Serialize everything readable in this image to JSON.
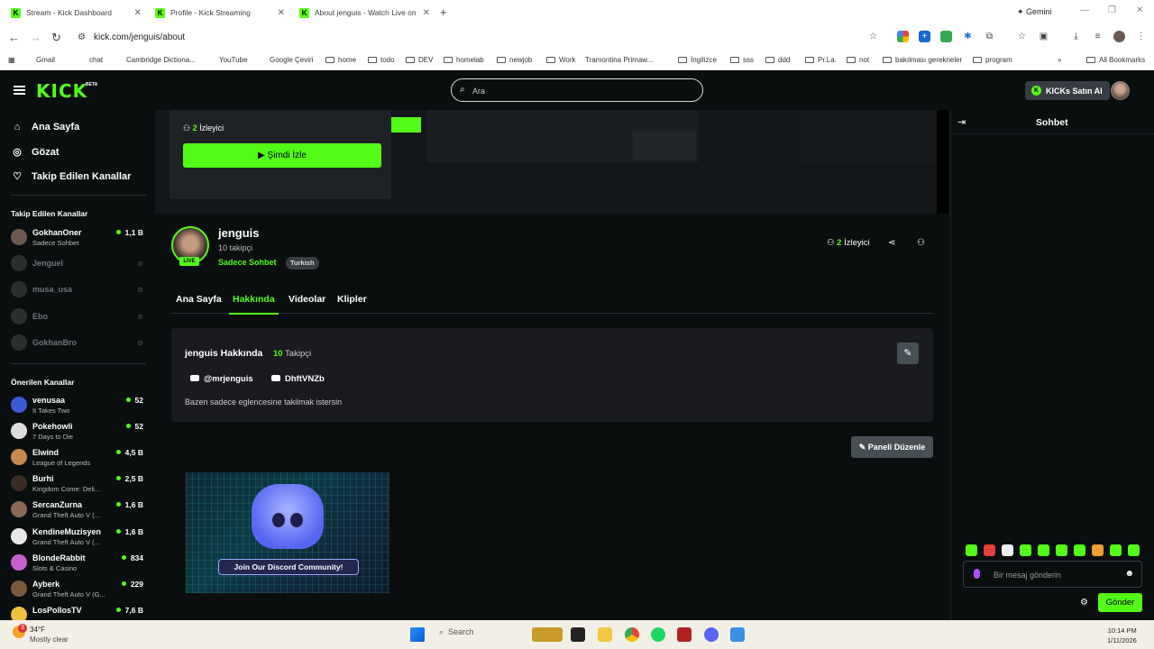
{
  "browser": {
    "tabs": [
      {
        "title": "Stream - Kick Dashboard"
      },
      {
        "title": "Profile - Kick Streaming"
      },
      {
        "title": "About jenguis - Watch Live on"
      }
    ],
    "gemini_label": "Gemini",
    "url": "kick.com/jenguis/about",
    "bookmarks": [
      "Gmail",
      "chat",
      "Cambridge Dictiona...",
      "YouTube",
      "Google Çeviri",
      "home",
      "todo",
      "DEV",
      "homelab",
      "newjob",
      "Work",
      "Tramontina Primaw...",
      "İngilizce",
      "sss",
      "ddd",
      "Pr.La.",
      "not",
      "bakılması gerekneler",
      "program"
    ],
    "all_bookmarks": "All Bookmarks"
  },
  "header": {
    "logo": "KICK",
    "beta": "BETA",
    "search_placeholder": "Ara",
    "buy_kicks": "KICKs Satın Al"
  },
  "sidebar": {
    "nav": [
      {
        "label": "Ana Sayfa",
        "icon": "home-icon"
      },
      {
        "label": "Gözat",
        "icon": "compass-icon"
      },
      {
        "label": "Takip Edilen Kanallar",
        "icon": "heart-icon"
      }
    ],
    "followed_heading": "Takip Edilen Kanallar",
    "followed": [
      {
        "name": "GokhanOner",
        "sub": "Sadece Sohbet",
        "viewers": "1,1 B",
        "live": true
      },
      {
        "name": "Jenguel",
        "live": false
      },
      {
        "name": "musa_usa",
        "live": false
      },
      {
        "name": "Ebo",
        "live": false
      },
      {
        "name": "GokhanBro",
        "live": false
      }
    ],
    "recommended_heading": "Önerilen Kanallar",
    "recommended": [
      {
        "name": "venusaa",
        "sub": "It Takes Two",
        "viewers": "52"
      },
      {
        "name": "Pokehowli",
        "sub": "7 Days to Die",
        "viewers": "52"
      },
      {
        "name": "Elwind",
        "sub": "League of Legends",
        "viewers": "4,5 B"
      },
      {
        "name": "Burhi",
        "sub": "Kingdom Come: Deli...",
        "viewers": "2,5 B"
      },
      {
        "name": "SercanZurna",
        "sub": "Grand Theft Auto V (...",
        "viewers": "1,6 B"
      },
      {
        "name": "KendineMuzisyen",
        "sub": "Grand Theft Auto V (...",
        "viewers": "1,6 B"
      },
      {
        "name": "BlondeRabbit",
        "sub": "Slots & Casino",
        "viewers": "834"
      },
      {
        "name": "Ayberk",
        "sub": "Grand Theft Auto V (G...",
        "viewers": "229"
      },
      {
        "name": "LosPollosTV",
        "sub": "",
        "viewers": "7,6 B"
      }
    ]
  },
  "player": {
    "viewers_count": "2",
    "viewers_label": "İzleyici",
    "watch_now": "▶ Şimdi İzle"
  },
  "profile": {
    "name": "jenguis",
    "followers": "10 takipçi",
    "category": "Sadece Sohbet",
    "tag": "Turkish",
    "live_badge": "LIVE",
    "viewers_count": "2",
    "viewers_label": "İzleyici"
  },
  "tabs": [
    {
      "label": "Ana Sayfa"
    },
    {
      "label": "Hakkında"
    },
    {
      "label": "Videolar"
    },
    {
      "label": "Klipler"
    }
  ],
  "about": {
    "title": "jenguis Hakkında",
    "follower_count": "10",
    "follower_label": "Takipçi",
    "youtube": "@mrjenguis",
    "discord": "DhftVNZb",
    "description": "Bazen sadece eglencesine takilmak istersin"
  },
  "panel_edit": "Paneli Düzenle",
  "discord_panel": {
    "cta": "Join Our Discord Community!"
  },
  "chat": {
    "title": "Sohbet",
    "placeholder": "Bir mesaj gönderin",
    "send": "Gönder"
  },
  "taskbar": {
    "temperature": "34°F",
    "condition": "Mostly clear",
    "weather_badge": "3",
    "search": "Search",
    "time": "10:14 PM",
    "date": "1/11/2026"
  },
  "colors": {
    "accent": "#53fc18",
    "bg": "#0b0e0f",
    "panel": "#191b1f"
  }
}
